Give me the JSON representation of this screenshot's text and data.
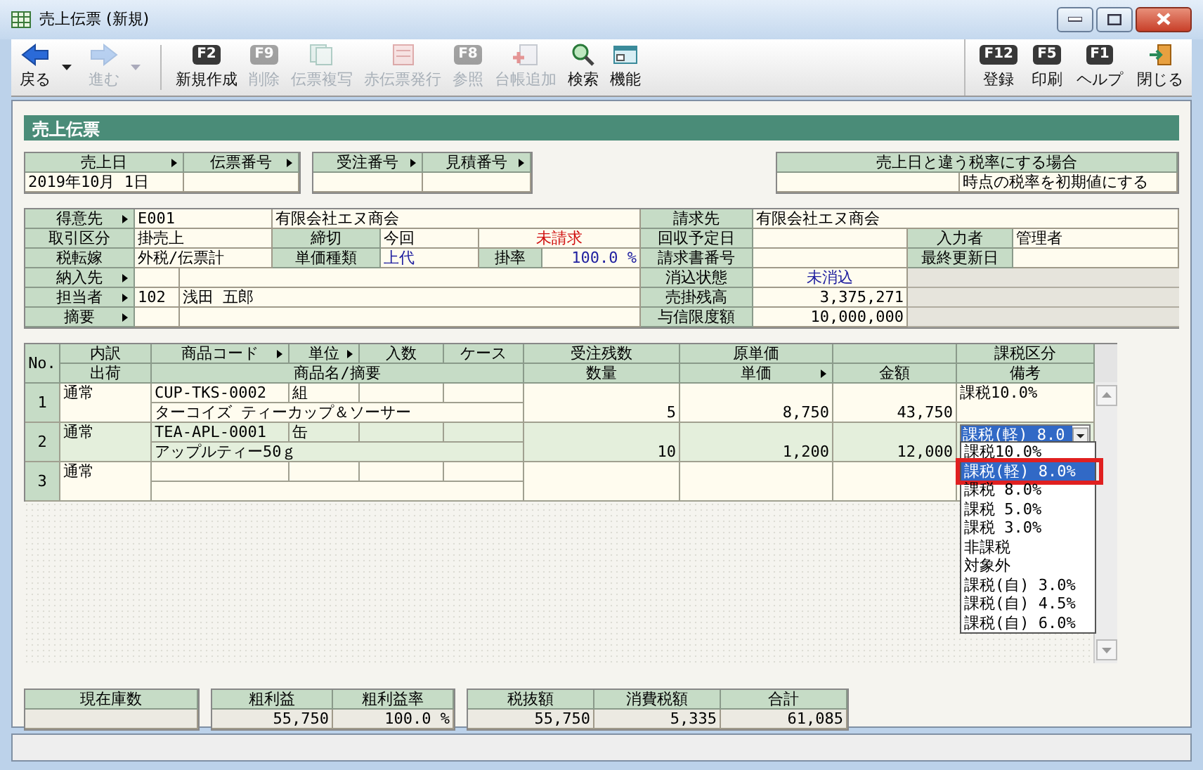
{
  "window": {
    "title": "売上伝票 (新規)"
  },
  "toolbar": {
    "left": [
      {
        "label": "戻る",
        "kind": "back",
        "disabled": false
      },
      {
        "label": "進む",
        "kind": "forward",
        "disabled": true
      },
      {
        "label": "新規作成",
        "kind": "fkey",
        "fkey": "F2",
        "disabled": false
      },
      {
        "label": "削除",
        "kind": "fkey",
        "fkey": "F9",
        "disabled": true
      },
      {
        "label": "伝票複写",
        "kind": "copy",
        "disabled": true
      },
      {
        "label": "赤伝票発行",
        "kind": "red",
        "disabled": true
      },
      {
        "label": "参照",
        "kind": "fkey",
        "fkey": "F8",
        "disabled": true
      },
      {
        "label": "台帳追加",
        "kind": "add",
        "disabled": true
      },
      {
        "label": "検索",
        "kind": "search",
        "disabled": false
      },
      {
        "label": "機能",
        "kind": "function",
        "disabled": false
      }
    ],
    "right": [
      {
        "label": "登録",
        "kind": "fkey",
        "fkey": "F12",
        "disabled": false
      },
      {
        "label": "印刷",
        "kind": "fkey",
        "fkey": "F5",
        "disabled": false
      },
      {
        "label": "ヘルプ",
        "kind": "fkey",
        "fkey": "F1",
        "disabled": false
      },
      {
        "label": "閉じる",
        "kind": "close",
        "disabled": false
      }
    ]
  },
  "section_title": "売上伝票",
  "slip_fields": [
    {
      "label": "売上日",
      "lookup": true,
      "value": "2019年10月 1日"
    },
    {
      "label": "伝票番号",
      "lookup": true
    },
    {
      "label": "受注番号",
      "lookup": true
    },
    {
      "label": "見積番号",
      "lookup": true
    }
  ],
  "tax_rate_note": {
    "title": "売上日と違う税率にする場合",
    "value": "時点の税率を初期値にする"
  },
  "form": {
    "rows": [
      [
        {
          "kind": "label",
          "text": "得意先",
          "lookup": true
        },
        {
          "kind": "value",
          "text": "E001",
          "colspan": 2
        },
        {
          "kind": "value",
          "text": "有限会社エヌ商会",
          "colspan": 4
        },
        {
          "kind": "label",
          "text": "請求先"
        },
        {
          "kind": "value",
          "text": "有限会社エヌ商会",
          "colspan": 3
        }
      ],
      [
        {
          "kind": "label",
          "text": "取引区分"
        },
        {
          "kind": "value",
          "text": "掛売上",
          "colspan": 2
        },
        {
          "kind": "label",
          "text": "締切"
        },
        {
          "kind": "value",
          "text": "今回"
        },
        {
          "kind": "status",
          "text": "未請求",
          "color": "#d01010",
          "colspan": 2
        },
        {
          "kind": "label",
          "text": "回収予定日"
        },
        {
          "kind": "value"
        },
        {
          "kind": "label",
          "text": "入力者"
        },
        {
          "kind": "value",
          "text": "管理者"
        }
      ],
      [
        {
          "kind": "label",
          "text": "税転嫁"
        },
        {
          "kind": "value",
          "text": "外税/伝票計",
          "colspan": 2
        },
        {
          "kind": "label",
          "text": "単価種類"
        },
        {
          "kind": "value",
          "text": "上代",
          "color": "#2020a0"
        },
        {
          "kind": "label",
          "text": "掛率"
        },
        {
          "kind": "number",
          "text": "100.0 %",
          "color": "#2020a0"
        },
        {
          "kind": "label",
          "text": "請求書番号"
        },
        {
          "kind": "value"
        },
        {
          "kind": "label",
          "text": "最終更新日"
        },
        {
          "kind": "value"
        }
      ],
      [
        {
          "kind": "label",
          "text": "納入先",
          "lookup": true
        },
        {
          "kind": "value"
        },
        {
          "kind": "value",
          "colspan": 5
        },
        {
          "kind": "label",
          "text": "消込状態"
        },
        {
          "kind": "status",
          "text": "未消込",
          "color": "#2020a0"
        },
        {
          "kind": "blank",
          "colspan": 2
        }
      ],
      [
        {
          "kind": "label",
          "text": "担当者",
          "lookup": true
        },
        {
          "kind": "value",
          "text": "102"
        },
        {
          "kind": "value",
          "text": "浅田 五郎",
          "colspan": 5
        },
        {
          "kind": "label",
          "text": "売掛残高"
        },
        {
          "kind": "number",
          "text": "3,375,271"
        },
        {
          "kind": "blank",
          "colspan": 2
        }
      ],
      [
        {
          "kind": "label",
          "text": "摘要",
          "lookup": true
        },
        {
          "kind": "value"
        },
        {
          "kind": "value",
          "colspan": 5
        },
        {
          "kind": "label",
          "text": "与信限度額"
        },
        {
          "kind": "number",
          "text": "10,000,000"
        },
        {
          "kind": "blank",
          "colspan": 2
        }
      ]
    ]
  },
  "lines": {
    "columns_top": [
      {
        "label": "No."
      },
      {
        "label": "内訳"
      },
      {
        "label": "商品コード",
        "lookup": true
      },
      {
        "label": "単位",
        "lookup": true
      },
      {
        "label": "入数"
      },
      {
        "label": "ケース"
      },
      {
        "label": "受注残数"
      },
      {
        "label": "原単価"
      },
      {
        "label": "課税区分"
      }
    ],
    "columns_bottom": [
      {
        "label": "出荷"
      },
      {
        "label": "商品名/摘要"
      },
      {
        "label": "数量"
      },
      {
        "label": "単価",
        "lookup": true
      },
      {
        "label": "金額"
      },
      {
        "label": "備考"
      }
    ],
    "rows": [
      {
        "no": "1",
        "breakdown": "通常",
        "code": "CUP-TKS-0002",
        "unit": "組",
        "name": "ターコイズ ティーカップ＆ソーサー",
        "quantity": "5",
        "unit_price": "8,750",
        "amount": "43,750",
        "tax": "課税10.0%",
        "selected": false,
        "editing": false
      },
      {
        "no": "2",
        "breakdown": "通常",
        "code": "TEA-APL-0001",
        "unit": "缶",
        "name": "アップルティー50ｇ",
        "quantity": "10",
        "unit_price": "1,200",
        "amount": "12,000",
        "tax": "課税(軽) 8.0",
        "selected": true,
        "editing": true
      },
      {
        "no": "3",
        "breakdown": "通常",
        "selected": false,
        "editing": false
      }
    ]
  },
  "tax_dropdown": {
    "options": [
      {
        "label": "課税10.0%",
        "selected": false,
        "highlighted": false
      },
      {
        "label": "課税(軽) 8.0%",
        "selected": true,
        "highlighted": true
      },
      {
        "label": "課税 8.0%",
        "selected": false,
        "highlighted": false
      },
      {
        "label": "課税 5.0%",
        "selected": false,
        "highlighted": false
      },
      {
        "label": "課税 3.0%",
        "selected": false,
        "highlighted": false
      },
      {
        "label": "非課税",
        "selected": false,
        "highlighted": false
      },
      {
        "label": "対象外",
        "selected": false,
        "highlighted": false
      },
      {
        "label": "課税(自) 3.0%",
        "selected": false,
        "highlighted": false
      },
      {
        "label": "課税(自) 4.5%",
        "selected": false,
        "highlighted": false
      },
      {
        "label": "課税(自) 6.0%",
        "selected": false,
        "highlighted": false
      }
    ]
  },
  "totals": [
    {
      "fields": [
        {
          "label": "現在庫数"
        }
      ]
    },
    {
      "fields": [
        {
          "label": "粗利益",
          "value": "55,750"
        },
        {
          "label": "粗利益率",
          "value": "100.0 %"
        }
      ]
    },
    {
      "fields": [
        {
          "label": "税抜額",
          "value": "55,750"
        },
        {
          "label": "消費税額",
          "value": "5,335"
        },
        {
          "label": "合計",
          "value": "61,085"
        }
      ]
    }
  ]
}
